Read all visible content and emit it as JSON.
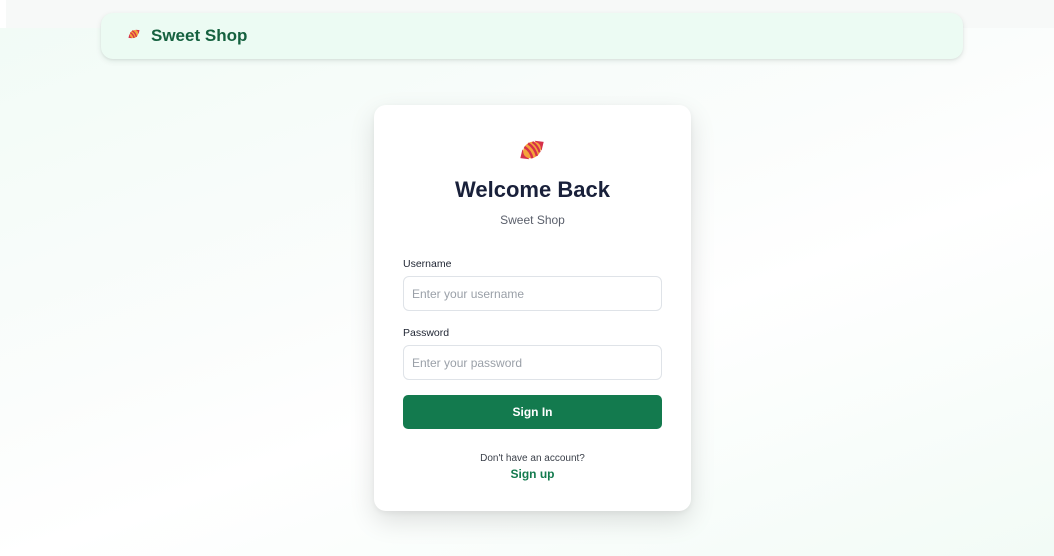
{
  "navbar": {
    "brand_icon": "candy-icon",
    "brand_name": "Sweet Shop"
  },
  "login": {
    "logo_icon": "candy-icon",
    "title": "Welcome Back",
    "subtitle": "Sweet Shop",
    "username_label": "Username",
    "username_placeholder": "Enter your username",
    "username_value": "",
    "password_label": "Password",
    "password_placeholder": "Enter your password",
    "password_value": "",
    "submit_label": "Sign In",
    "signup_prompt": "Don't have an account?",
    "signup_link": "Sign up"
  },
  "colors": {
    "brand_green": "#137a4e",
    "navbar_bg": "#ecfbf3",
    "title_text": "#19203a"
  }
}
